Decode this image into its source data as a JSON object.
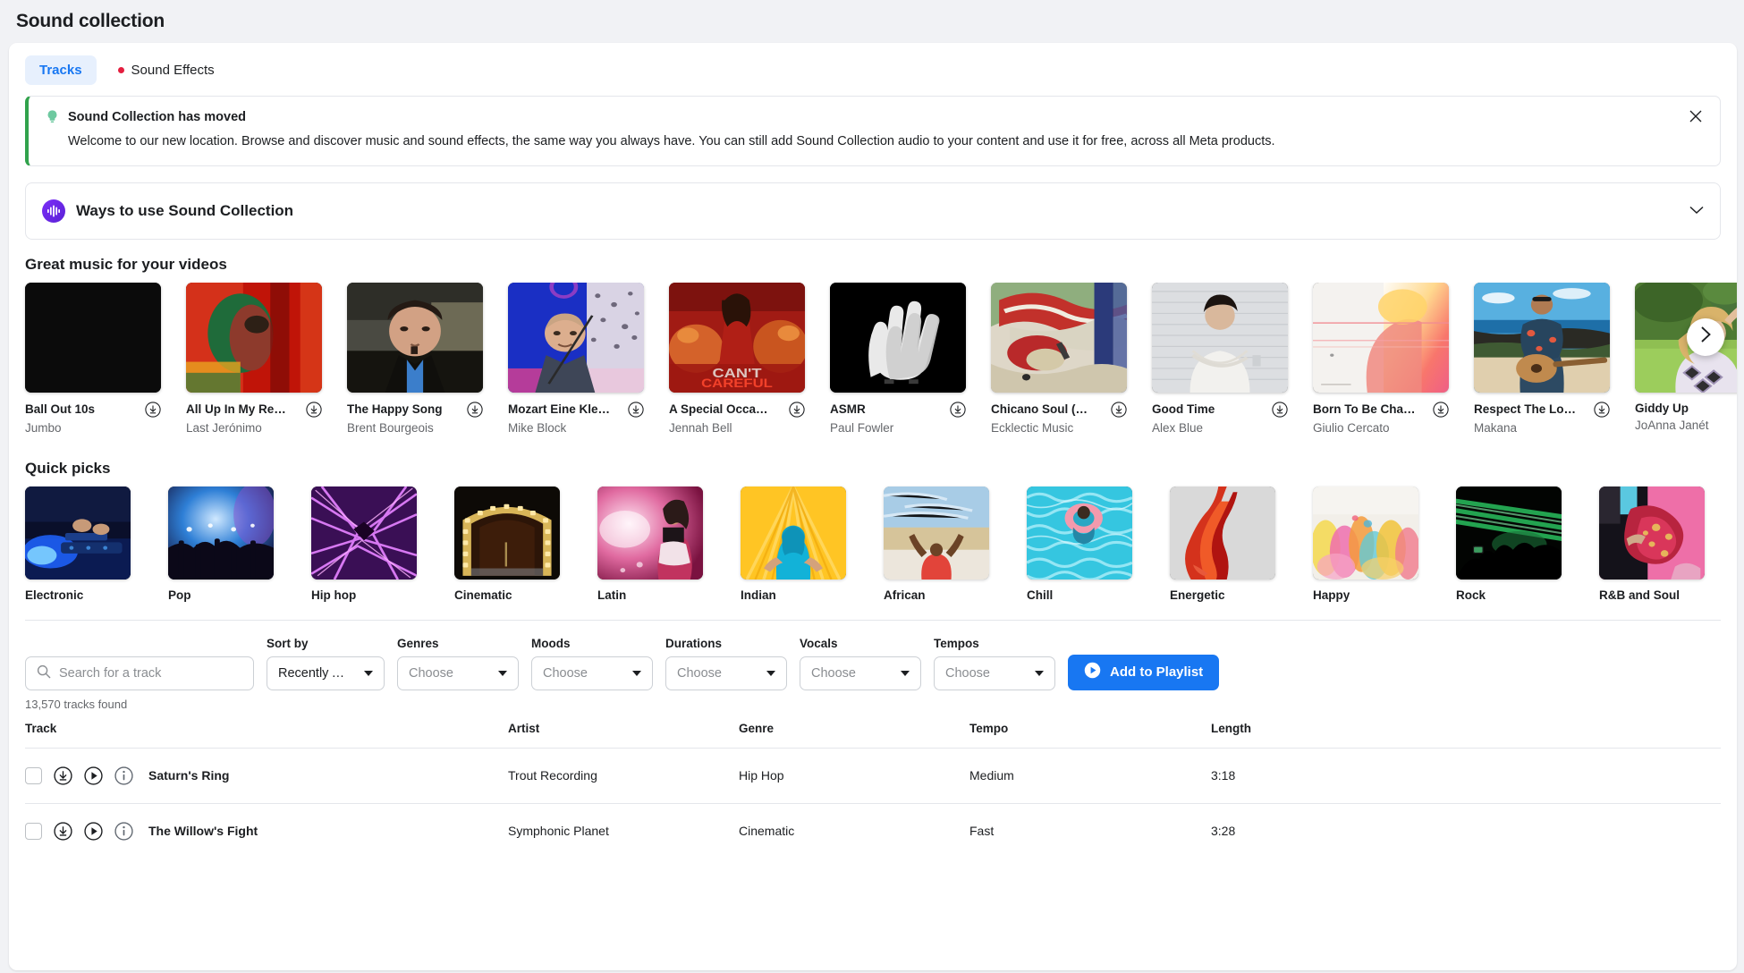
{
  "page": {
    "title": "Sound collection"
  },
  "tabs": [
    {
      "label": "Tracks",
      "active": true
    },
    {
      "label": "Sound Effects",
      "active": false,
      "badge": "dot"
    }
  ],
  "notice": {
    "icon": "lightbulb-icon",
    "title": "Sound Collection has moved",
    "body": "Welcome to our new location. Browse and discover music and sound effects, the same way you always have. You can still add Sound Collection audio to your content and use it for free, across all Meta products.",
    "close_icon": "close-icon",
    "accent_color": "#31a24c"
  },
  "ways_row": {
    "icon": "waveform-icon",
    "label": "Ways to use Sound Collection",
    "chevron": "chevron-down-icon",
    "icon_color": "#6b21d4"
  },
  "music_section": {
    "heading": "Great music for your videos",
    "next_icon": "chevron-right-icon",
    "download_icon": "download-icon",
    "cards": [
      {
        "title": "Ball Out 10s",
        "artist": "Jumbo"
      },
      {
        "title": "All Up In My Re…",
        "artist": "Last Jerónimo"
      },
      {
        "title": "The Happy Song",
        "artist": "Brent Bourgeois"
      },
      {
        "title": "Mozart Eine Kle…",
        "artist": "Mike Block"
      },
      {
        "title": "A Special Occa…",
        "artist": "Jennah Bell"
      },
      {
        "title": "ASMR",
        "artist": "Paul Fowler"
      },
      {
        "title": "Chicano Soul (…",
        "artist": "Ecklectic Music"
      },
      {
        "title": "Good Time",
        "artist": "Alex Blue"
      },
      {
        "title": "Born To Be Cha…",
        "artist": "Giulio Cercato"
      },
      {
        "title": "Respect The Lo…",
        "artist": "Makana"
      },
      {
        "title": "Giddy Up",
        "artist": "JoAnna Janét"
      }
    ]
  },
  "quick_picks": {
    "heading": "Quick picks",
    "items": [
      {
        "label": "Electronic"
      },
      {
        "label": "Pop"
      },
      {
        "label": "Hip hop"
      },
      {
        "label": "Cinematic"
      },
      {
        "label": "Latin"
      },
      {
        "label": "Indian"
      },
      {
        "label": "African"
      },
      {
        "label": "Chill"
      },
      {
        "label": "Energetic"
      },
      {
        "label": "Happy"
      },
      {
        "label": "Rock"
      },
      {
        "label": "R&B and Soul"
      }
    ]
  },
  "filters": {
    "search": {
      "placeholder": "Search for a track",
      "value": "",
      "icon": "search-icon"
    },
    "sort_by": {
      "label": "Sort by",
      "value": "Recently Ad…"
    },
    "genres": {
      "label": "Genres",
      "value": "Choose"
    },
    "moods": {
      "label": "Moods",
      "value": "Choose"
    },
    "durations": {
      "label": "Durations",
      "value": "Choose"
    },
    "vocals": {
      "label": "Vocals",
      "value": "Choose"
    },
    "tempos": {
      "label": "Tempos",
      "value": "Choose"
    },
    "add_to_playlist": {
      "label": "Add to Playlist",
      "icon": "play-circle-icon",
      "color": "#1877f2"
    },
    "results_count": "13,570 tracks found"
  },
  "table": {
    "columns": [
      "Track",
      "Artist",
      "Genre",
      "Tempo",
      "Length"
    ],
    "rows": [
      {
        "track": "Saturn's Ring",
        "artist": "Trout Recording",
        "genre": "Hip Hop",
        "tempo": "Medium",
        "length": "3:18"
      },
      {
        "track": "The Willow's Fight",
        "artist": "Symphonic Planet",
        "genre": "Cinematic",
        "tempo": "Fast",
        "length": "3:28"
      }
    ]
  }
}
